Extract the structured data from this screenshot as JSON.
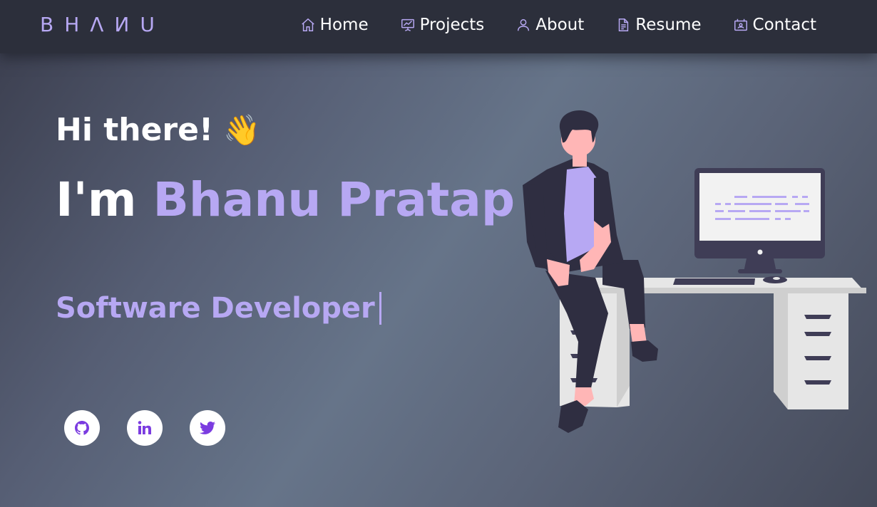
{
  "brand": {
    "logo_text": "BHΛИU",
    "color": "#b7a8f3"
  },
  "nav": {
    "items": [
      {
        "label": "Home",
        "icon": "home-icon"
      },
      {
        "label": "Projects",
        "icon": "presentation-chart-icon"
      },
      {
        "label": "About",
        "icon": "user-icon"
      },
      {
        "label": "Resume",
        "icon": "document-icon"
      },
      {
        "label": "Contact",
        "icon": "contact-card-icon"
      }
    ]
  },
  "hero": {
    "greeting": "Hi there!",
    "wave_emoji": "👋",
    "intro_prefix": "I'm ",
    "name": "Bhanu Pratap",
    "role": "Software Developer"
  },
  "socials": [
    {
      "name": "GitHub",
      "icon": "github-icon"
    },
    {
      "name": "LinkedIn",
      "icon": "linkedin-icon"
    },
    {
      "name": "Twitter",
      "icon": "twitter-icon"
    }
  ],
  "colors": {
    "accent": "#b7a8f3",
    "navbar_bg": "#2c2f3b",
    "social_icon": "#7b3ce0"
  }
}
